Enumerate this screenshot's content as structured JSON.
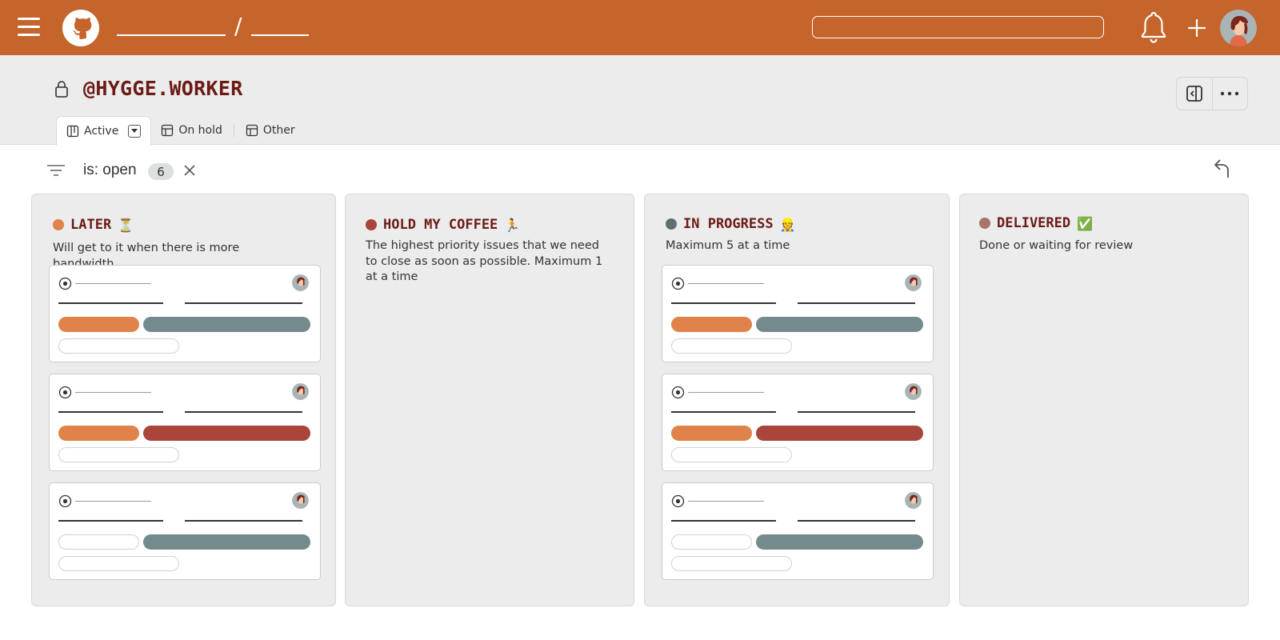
{
  "project": {
    "title": "@HYGGE.WORKER"
  },
  "tabs": [
    {
      "label": "Active"
    },
    {
      "label": "On hold"
    },
    {
      "label": "Other"
    }
  ],
  "filter": {
    "query": "is: open",
    "count": "6"
  },
  "colors": {
    "topbar": "#c5642b",
    "label_orange": "#e0834a",
    "label_gray": "#738b8c",
    "label_red": "#a9453a",
    "title_dark_red": "#6b1a16"
  },
  "icons": [
    "hamburger-icon",
    "github-logo-icon",
    "bell-icon",
    "plus-icon",
    "user-avatar",
    "lock-icon",
    "panel-toggle-icon",
    "more-icon",
    "board-icon",
    "table-icon",
    "filter-icon",
    "close-icon",
    "undo-icon",
    "open-issue-icon"
  ],
  "columns": [
    {
      "title": "LATER",
      "emoji": "⏳",
      "dot_color": "#e0834a",
      "description": "Will get to it when there is more bandwidth"
    },
    {
      "title": "HOLD MY COFFEE",
      "emoji": "🏃",
      "dot_color": "#a9453a",
      "description": "The highest priority issues that we need to close as soon as possible. Maximum 1 at a time"
    },
    {
      "title": "IN PROGRESS",
      "emoji": "👷",
      "dot_color": "#5e6f6f",
      "description": "Maximum 5 at a time"
    },
    {
      "title": "DELIVERED",
      "emoji": "✅",
      "dot_color": "#a9746a",
      "description": "Done or waiting for review"
    }
  ]
}
